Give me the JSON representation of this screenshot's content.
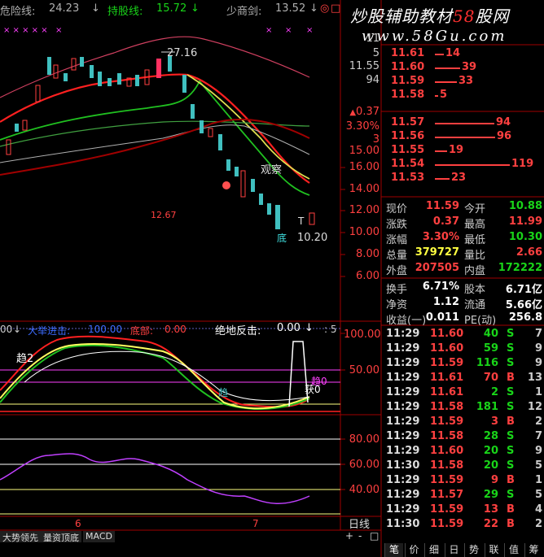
{
  "indicator_bar": {
    "danger_label": "危险线:",
    "danger_value": "24.23",
    "hold_label": "持股线:",
    "hold_value": "15.72",
    "shaojian_label": "少商剑:",
    "shaojian_value": "13.52"
  },
  "watermark": {
    "line1_a": "炒股辅助教材",
    "line1_b": "58",
    "line1_c": "股网",
    "line2": "www.58Gu.com"
  },
  "price_chart": {
    "high_label": "27.16",
    "low_label": "10.20",
    "side_label": "12.67",
    "observe_label": "观察",
    "t_label": "T",
    "di_label": "底",
    "axis": [
      "16.00",
      "14.00",
      "12.00",
      "10.00",
      "8.00",
      "6.00"
    ]
  },
  "order_book": {
    "asks": [
      {
        "price": "11.61",
        "vol": "14",
        "bar": 0.08
      },
      {
        "price": "11.60",
        "vol": "39",
        "bar": 0.22
      },
      {
        "price": "11.59",
        "vol": "33",
        "bar": 0.19
      },
      {
        "price": "11.58",
        "vol": "5",
        "bar": 0.03
      }
    ],
    "bids": [
      {
        "price": "11.57",
        "vol": "94",
        "bar": 0.52
      },
      {
        "price": "11.56",
        "vol": "96",
        "bar": 0.53
      },
      {
        "price": "11.55",
        "vol": "19",
        "bar": 0.11
      },
      {
        "price": "11.54",
        "vol": "119",
        "bar": 0.66
      },
      {
        "price": "11.53",
        "vol": "23",
        "bar": 0.13
      }
    ],
    "partial_labels": [
      "11",
      "5",
      "11.55",
      "94",
      "0.37",
      "3.30%",
      "3",
      "15.00"
    ]
  },
  "quote": [
    {
      "l1": "现价",
      "v1": "11.59",
      "c1": "#ff4040",
      "l2": "今开",
      "v2": "10.88",
      "c2": "#19d419"
    },
    {
      "l1": "涨跌",
      "v1": "0.37",
      "c1": "#ff4040",
      "l2": "最高",
      "v2": "11.99",
      "c2": "#ff4040"
    },
    {
      "l1": "涨幅",
      "v1": "3.30%",
      "c1": "#ff4040",
      "l2": "最低",
      "v2": "10.30",
      "c2": "#19d419"
    },
    {
      "l1": "总量",
      "v1": "379727",
      "c1": "#ffff40",
      "l2": "量比",
      "v2": "2.66",
      "c2": "#ff4040"
    },
    {
      "l1": "外盘",
      "v1": "207505",
      "c1": "#ff4040",
      "l2": "内盘",
      "v2": "172222",
      "c2": "#19d419"
    }
  ],
  "fundamentals": [
    {
      "l1": "换手",
      "v1": "6.71%",
      "l2": "股本",
      "v2": "6.71亿"
    },
    {
      "l1": "净资",
      "v1": "1.12",
      "l2": "流通",
      "v2": "5.66亿"
    },
    {
      "l1": "收益(一)",
      "v1": "0.011",
      "l2": "PE(动)",
      "v2": "256.8"
    }
  ],
  "ticks": [
    {
      "time": "11:29",
      "price": "11.60",
      "vol": "40",
      "side": "S",
      "n": "7"
    },
    {
      "time": "11:29",
      "price": "11.60",
      "vol": "59",
      "side": "S",
      "n": "9"
    },
    {
      "time": "11:29",
      "price": "11.59",
      "vol": "116",
      "side": "S",
      "n": "9"
    },
    {
      "time": "11:29",
      "price": "11.61",
      "vol": "70",
      "side": "B",
      "n": "13"
    },
    {
      "time": "11:29",
      "price": "11.61",
      "vol": "2",
      "side": "S",
      "n": "1"
    },
    {
      "time": "11:29",
      "price": "11.58",
      "vol": "181",
      "side": "S",
      "n": "12"
    },
    {
      "time": "11:29",
      "price": "11.59",
      "vol": "3",
      "side": "B",
      "n": "2"
    },
    {
      "time": "11:29",
      "price": "11.58",
      "vol": "28",
      "side": "S",
      "n": "7"
    },
    {
      "time": "11:29",
      "price": "11.60",
      "vol": "20",
      "side": "S",
      "n": "9"
    },
    {
      "time": "11:30",
      "price": "11.58",
      "vol": "20",
      "side": "S",
      "n": "5"
    },
    {
      "time": "11:29",
      "price": "11.59",
      "vol": "9",
      "side": "B",
      "n": "1"
    },
    {
      "time": "11:29",
      "price": "11.57",
      "vol": "29",
      "side": "S",
      "n": "5"
    },
    {
      "time": "11:29",
      "price": "11.59",
      "vol": "13",
      "side": "B",
      "n": "4"
    },
    {
      "time": "11:30",
      "price": "11.59",
      "vol": "22",
      "side": "B",
      "n": "2"
    }
  ],
  "mid_panel": {
    "left_value": "00",
    "big_entry_label": "大举进击:",
    "big_entry_value": "100.00",
    "bottom_label": "底部:",
    "bottom_value": "0.00",
    "counter_label": "绝地反击:",
    "counter_value": "0.00",
    "right_partial": "5",
    "trend2": "趋2",
    "qu_label": "趋",
    "trend0": "趋0",
    "huo0": "获0",
    "axis": [
      "100.00",
      "50.00"
    ]
  },
  "lower_panel": {
    "axis": [
      "80.00",
      "60.00",
      "40.00"
    ]
  },
  "date_axis": {
    "m6": "6",
    "m7": "7"
  },
  "period_label": "日线",
  "bottom_tabs": [
    "大势领先",
    "量资顶底",
    "MACD"
  ],
  "zoom": {
    "plus": "+",
    "minus": "-",
    "box": "□"
  },
  "right_tabs": [
    "笔",
    "价",
    "细",
    "日",
    "势",
    "联",
    "值",
    "筹"
  ]
}
